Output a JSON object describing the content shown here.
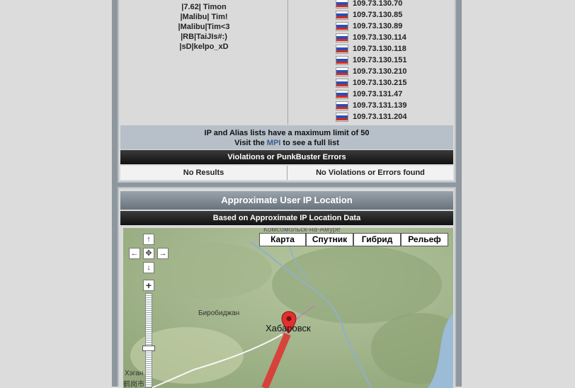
{
  "aliases": [
    "|7.62| Timon",
    "|Malibu| Tim!",
    "|Malibu|Tim<3",
    "|RB|TaiJIs#:)",
    "|sD|kelpo_xD"
  ],
  "ips": [
    "109.73.130.70",
    "109.73.130.85",
    "109.73.130.89",
    "109.73.130.114",
    "109.73.130.118",
    "109.73.130.151",
    "109.73.130.210",
    "109.73.130.215",
    "109.73.131.47",
    "109.73.131.139",
    "109.73.131.204"
  ],
  "flag_colors": [
    "#ffffff",
    "#2a4fb5",
    "#d52b1e"
  ],
  "note": {
    "line1": "IP and Alias lists have a maximum limit of 50",
    "visit": "Visit the",
    "mpi": "MPI",
    "rest": "to see a full list"
  },
  "violations": {
    "header": "Violations or PunkBuster Errors",
    "left": "No Results",
    "right": "No Violations or Errors found"
  },
  "location": {
    "title": "Approximate User IP Location",
    "subtitle": "Based on Approximate IP Location Data"
  },
  "map": {
    "types": [
      "Карта",
      "Спутник",
      "Гибрид",
      "Рельеф"
    ],
    "labels": {
      "city": "Хабаровск",
      "birobidzhan": "Биробиджан",
      "hegang": "Хэган",
      "hegang_cn": "鹤岗市",
      "top": "Комсомольск-на-Амуре"
    },
    "marker_color": "#e03030",
    "controls": {
      "up": "↑",
      "down": "↓",
      "left": "←",
      "right": "→",
      "center": "✥",
      "zoom_in": "+"
    }
  }
}
